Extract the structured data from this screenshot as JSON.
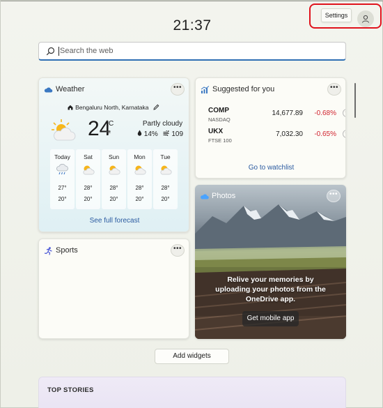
{
  "header": {
    "time": "21:37",
    "settings_label": "Settings",
    "avatar_icon": "person-icon"
  },
  "search": {
    "placeholder": "Search the web"
  },
  "weather": {
    "title": "Weather",
    "location": "Bengaluru North, Karnataka",
    "temperature": "24",
    "unit_c": "°C",
    "unit_f": "°F",
    "condition": "Partly cloudy",
    "precipitation": "14%",
    "wind": "109",
    "forecast": [
      {
        "day": "Today",
        "hi": "27°",
        "lo": "20°",
        "icon": "rain-cloud-icon"
      },
      {
        "day": "Sat",
        "hi": "28°",
        "lo": "20°",
        "icon": "partly-cloudy-icon"
      },
      {
        "day": "Sun",
        "hi": "28°",
        "lo": "20°",
        "icon": "partly-cloudy-icon"
      },
      {
        "day": "Mon",
        "hi": "28°",
        "lo": "20°",
        "icon": "partly-cloudy-icon"
      },
      {
        "day": "Tue",
        "hi": "28°",
        "lo": "20°",
        "icon": "partly-cloudy-icon"
      }
    ],
    "link": "See full forecast"
  },
  "stocks": {
    "title": "Suggested for you",
    "items": [
      {
        "symbol": "COMP",
        "exchange": "NASDAQ",
        "value": "14,677.89",
        "change": "-0.68%"
      },
      {
        "symbol": "UKX",
        "exchange": "FTSE 100",
        "value": "7,032.30",
        "change": "-0.65%"
      }
    ],
    "link": "Go to watchlist"
  },
  "photos": {
    "title": "Photos",
    "message": "Relive your memories by uploading your photos from the OneDrive app.",
    "button": "Get mobile app"
  },
  "sports": {
    "title": "Sports"
  },
  "add_widgets_label": "Add widgets",
  "top_stories_label": "TOP STORIES",
  "colors": {
    "accent": "#2f6fb3",
    "negative": "#d1242f",
    "highlight": "#e0121c"
  }
}
